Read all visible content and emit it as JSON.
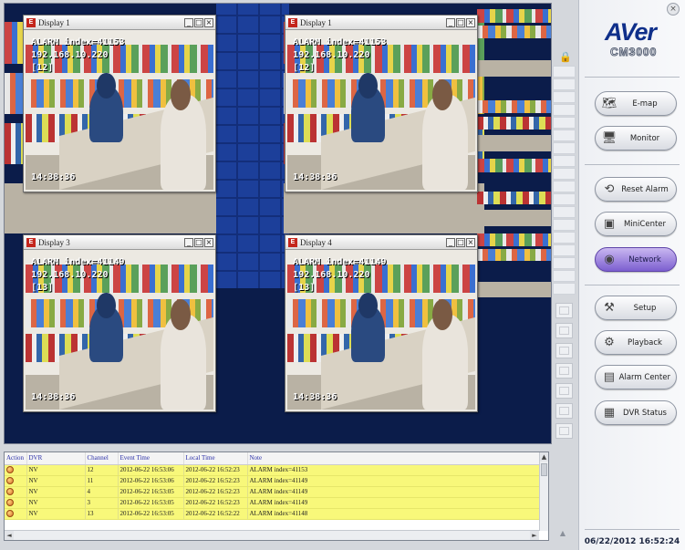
{
  "displays": [
    {
      "title": "Display 1",
      "alarm": "ALARM index=41153",
      "ip": "192.168.10.220",
      "ch": "[12]",
      "time": "14:38:36"
    },
    {
      "title": "Display 1",
      "alarm": "ALARM index=41153",
      "ip": "192.168.10.220",
      "ch": "[12]",
      "time": "14:38:36"
    },
    {
      "title": "Display 3",
      "alarm": "ALARM index=41149",
      "ip": "192.168.10.220",
      "ch": "[13]",
      "time": "14:38:36"
    },
    {
      "title": "Display 4",
      "alarm": "ALARM index=41149",
      "ip": "192.168.10.220",
      "ch": "[13]",
      "time": "14:38:36"
    }
  ],
  "window_buttons": {
    "minimize": "_",
    "maximize": "□",
    "close": "×"
  },
  "brand": {
    "logo": "AVer",
    "product": "CM3000",
    "close": "×"
  },
  "nav": [
    {
      "label": "E-map",
      "icon": "map-icon"
    },
    {
      "label": "Monitor",
      "icon": "monitor-icon"
    },
    {
      "label": "Reset Alarm",
      "icon": "reset-alarm-icon"
    },
    {
      "label": "MiniCenter",
      "icon": "minicenter-icon"
    },
    {
      "label": "Network",
      "icon": "network-icon",
      "active": true
    },
    {
      "label": "Setup",
      "icon": "setup-icon"
    },
    {
      "label": "Playback",
      "icon": "playback-icon"
    },
    {
      "label": "Alarm Center",
      "icon": "alarm-center-icon"
    },
    {
      "label": "DVR Status",
      "icon": "dvr-status-icon"
    }
  ],
  "clock": "06/22/2012 16:52:24",
  "alarm_table": {
    "columns": [
      "Action",
      "DVR",
      "Channel",
      "Event Time",
      "Local Time",
      "Note"
    ],
    "rows": [
      {
        "dvr": "NV",
        "channel": "12",
        "event_time": "2012-06-22 16:53:06",
        "local_time": "2012-06-22 16:52:23",
        "note": "ALARM index=41153"
      },
      {
        "dvr": "NV",
        "channel": "11",
        "event_time": "2012-06-22 16:53:06",
        "local_time": "2012-06-22 16:52:23",
        "note": "ALARM index=41149"
      },
      {
        "dvr": "NV",
        "channel": "4",
        "event_time": "2012-06-22 16:53:05",
        "local_time": "2012-06-22 16:52:23",
        "note": "ALARM index=41149"
      },
      {
        "dvr": "NV",
        "channel": "3",
        "event_time": "2012-06-22 16:53:05",
        "local_time": "2012-06-22 16:52:23",
        "note": "ALARM index=41149"
      },
      {
        "dvr": "NV",
        "channel": "13",
        "event_time": "2012-06-22 16:53:05",
        "local_time": "2012-06-22 16:52:22",
        "note": "ALARM index=41148"
      }
    ]
  },
  "scroll": {
    "up": "▲",
    "down": "▼",
    "left": "◄",
    "right": "►"
  },
  "lock_icon": "🔒"
}
